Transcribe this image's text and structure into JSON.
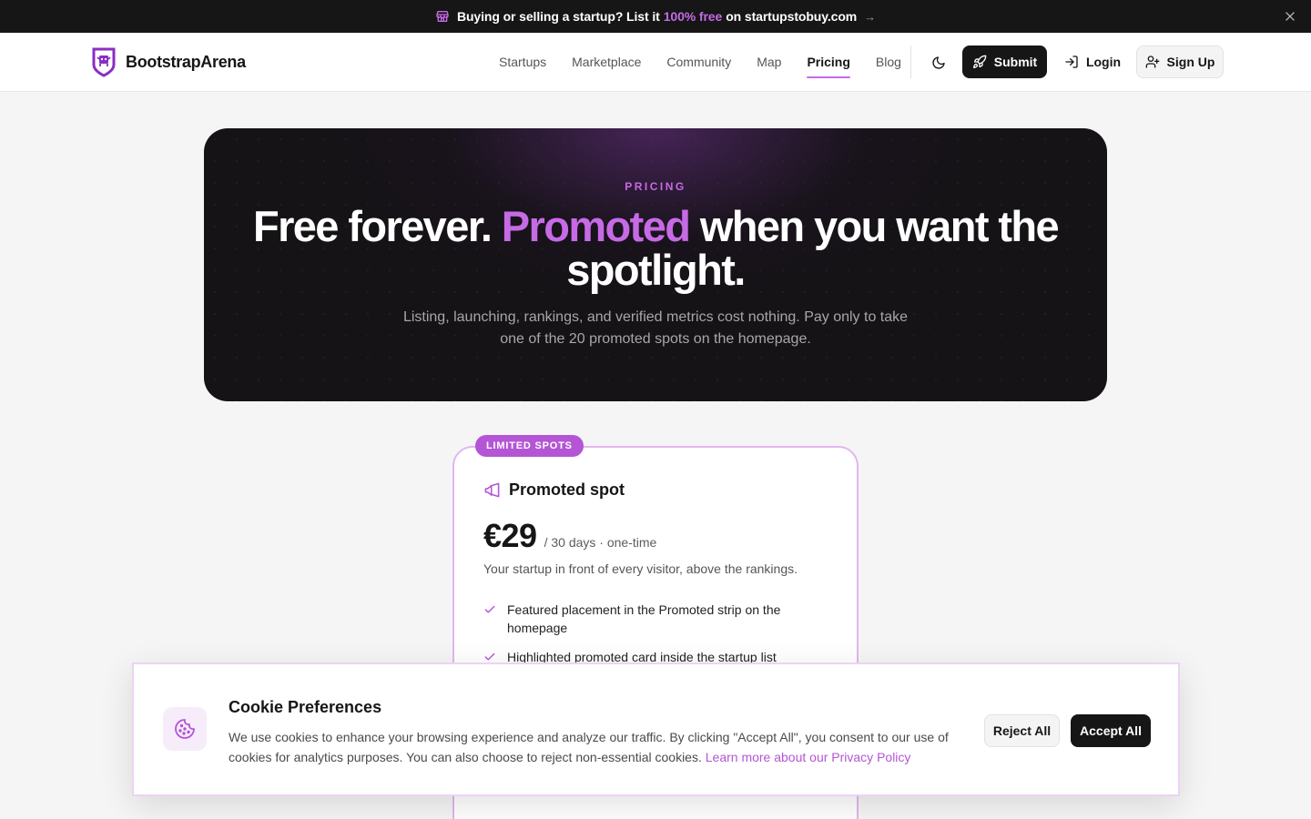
{
  "announcement": {
    "pre": "Buying or selling a startup? List it",
    "highlight": "100% free",
    "post": "on startupstobuy.com",
    "arrow": "→"
  },
  "header": {
    "brand": "BootstrapArena",
    "nav": [
      "Startups",
      "Marketplace",
      "Community",
      "Map",
      "Pricing",
      "Blog"
    ],
    "active_nav": "Pricing",
    "submit_label": "Submit",
    "login_label": "Login",
    "signup_label": "Sign Up"
  },
  "hero": {
    "eyebrow": "PRICING",
    "title_part1": "Free forever.",
    "title_accent": "Promoted",
    "title_part2": "when you want the spotlight.",
    "subtitle": "Listing, launching, rankings, and verified metrics cost nothing. Pay only to take one of the 20 promoted spots on the homepage."
  },
  "pricing_card": {
    "badge": "LIMITED SPOTS",
    "title": "Promoted spot",
    "price": "€29",
    "period": "/ 30 days · one-time",
    "description": "Your startup in front of every visitor, above the rankings.",
    "features": [
      "Featured placement in the Promoted strip on the homepage",
      "Highlighted promoted card inside the startup list"
    ]
  },
  "cookie": {
    "title": "Cookie Preferences",
    "text": "We use cookies to enhance your browsing experience and analyze our traffic. By clicking \"Accept All\", you consent to our use of cookies for analytics purposes. You can also choose to reject non-essential cookies.",
    "link": "Learn more about our Privacy Policy",
    "reject_label": "Reject All",
    "accept_label": "Accept All"
  },
  "colors": {
    "accent": "#c76ae6",
    "dark": "#161616",
    "background": "#f5f5f5"
  },
  "icons": [
    "store-icon",
    "close-icon",
    "shield-logo-icon",
    "moon-icon",
    "rocket-icon",
    "login-icon",
    "user-plus-icon",
    "megaphone-icon",
    "check-icon",
    "cookie-icon"
  ]
}
